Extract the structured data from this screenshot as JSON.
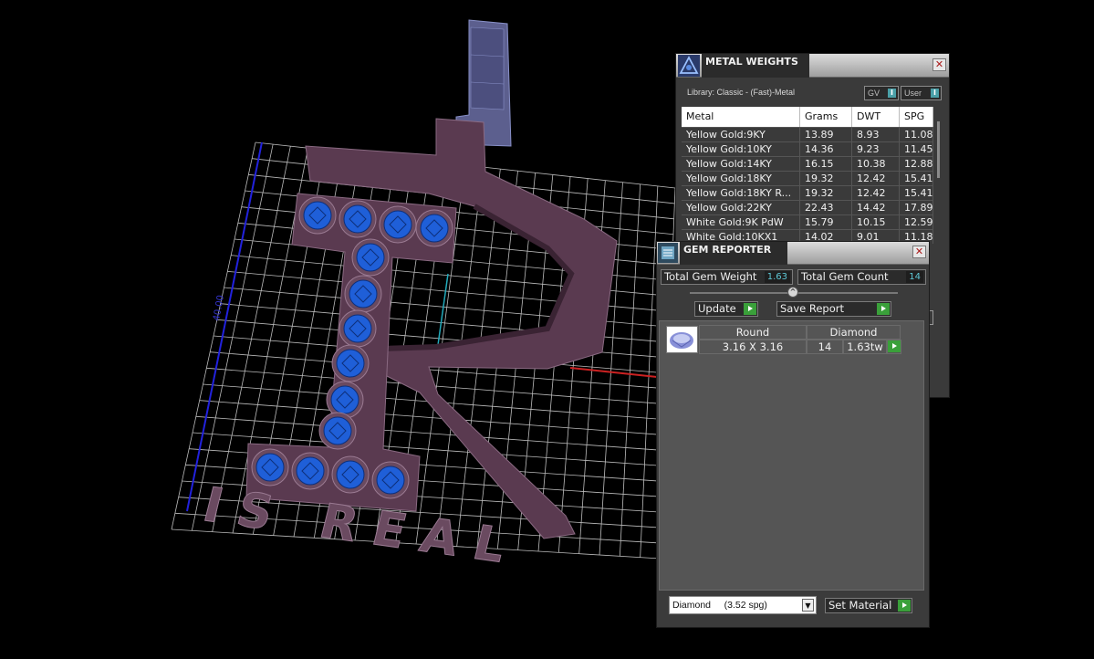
{
  "metal_weights": {
    "title": "METAL WEIGHTS",
    "library_label": "Library: Classic - (Fast)-Metal",
    "toggle_gv": "GV",
    "toggle_user": "User",
    "columns": [
      "Metal",
      "Grams",
      "DWT",
      "SPG"
    ],
    "rows": [
      [
        "Yellow Gold:9KY",
        "13.89",
        "8.93",
        "11.08"
      ],
      [
        "Yellow Gold:10KY",
        "14.36",
        "9.23",
        "11.45"
      ],
      [
        "Yellow Gold:14KY",
        "16.15",
        "10.38",
        "12.88"
      ],
      [
        "Yellow Gold:18KY",
        "19.32",
        "12.42",
        "15.41"
      ],
      [
        "Yellow Gold:18KY R...",
        "19.32",
        "12.42",
        "15.41"
      ],
      [
        "Yellow Gold:22KY",
        "22.43",
        "14.42",
        "17.89"
      ],
      [
        "White Gold:9K PdW",
        "15.79",
        "10.15",
        "12.59"
      ],
      [
        "White Gold:10KX1",
        "14.02",
        "9.01",
        "11.18"
      ]
    ]
  },
  "gem_reporter": {
    "title": "GEM REPORTER",
    "total_weight_label": "Total Gem Weight",
    "total_weight_value": "1.63",
    "total_count_label": "Total Gem Count",
    "total_count_value": "14",
    "update_label": "Update",
    "save_report_label": "Save Report",
    "gem": {
      "shape": "Round",
      "material": "Diamond",
      "size": "3.16 X 3.16",
      "count": "14",
      "weight": "1.63tw"
    },
    "material_select_value": "Diamond     (3.52 spg)",
    "set_material_label": "Set Material"
  },
  "viewport": {
    "dimension_label": "40.00",
    "pendant_text": "IS REAL"
  },
  "colors": {
    "metal": "#5a3a50",
    "gem_blue": "#1f5fd8",
    "grid": "#bbbbbb",
    "axis_blue": "#2222dd",
    "axis_red": "#cc2222",
    "axis_cyan": "#22aabb",
    "bail": "#5c5f8e"
  }
}
